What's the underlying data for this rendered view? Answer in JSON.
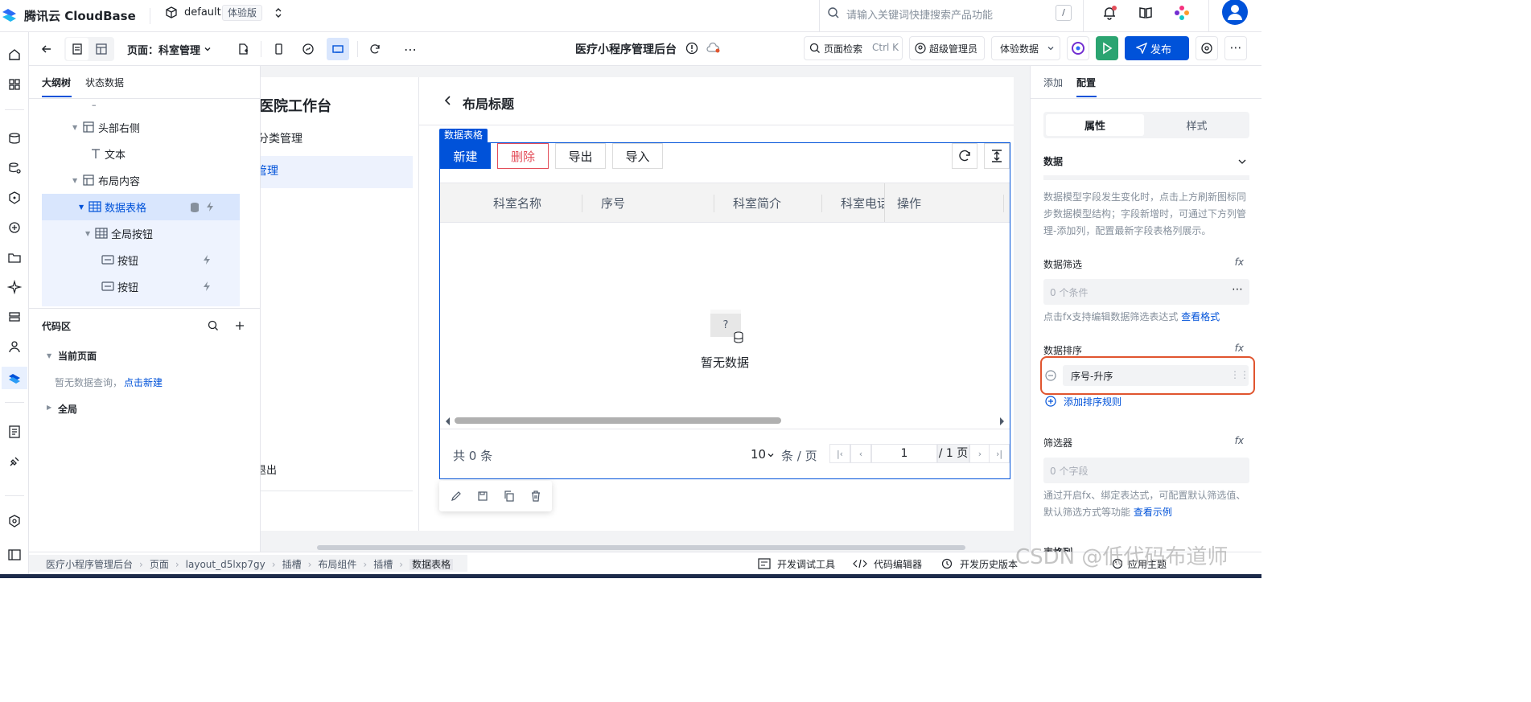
{
  "topbar": {
    "brand": "腾讯云 CloudBase",
    "env_name": "default",
    "env_badge": "体验版",
    "search_placeholder": "请输入关键词快捷搜索产品功能",
    "search_shortcut": "/"
  },
  "toolbar": {
    "page_label": "页面：科室管理",
    "app_title": "医疗小程序管理后台",
    "page_search": "页面检索",
    "page_search_shortcut": "Ctrl K",
    "role": "超级管理员",
    "data_mode": "体验数据",
    "publish": "发布"
  },
  "outline": {
    "tabs": [
      "大纲树",
      "状态数据"
    ],
    "dash": "–",
    "tree": [
      {
        "label": "头部右侧",
        "icon": "layout-icon"
      },
      {
        "label": "文本",
        "icon": "text-icon"
      },
      {
        "label": "布局内容",
        "icon": "layout-icon"
      },
      {
        "label": "数据表格",
        "icon": "table-icon"
      },
      {
        "label": "全局按钮",
        "icon": "table-icon"
      },
      {
        "label": "按钮",
        "icon": "button-icon"
      },
      {
        "label": "按钮",
        "icon": "button-icon"
      }
    ],
    "code": {
      "title": "代码区",
      "current_page": "当前页面",
      "empty_text": "暂无数据查询，",
      "create_link": "点击新建",
      "global": "全局"
    }
  },
  "canvas": {
    "sidebar_title": "医院工作台",
    "sidebar_items": [
      "分类管理",
      "管理"
    ],
    "logout": "退出",
    "header_title": "布局标题",
    "component_tag": "数据表格",
    "buttons": {
      "new": "新建",
      "delete": "删除",
      "export": "导出",
      "import": "导入"
    },
    "columns": [
      "科室名称",
      "序号",
      "科室简介",
      "科室电话",
      "操作"
    ],
    "empty": "暂无数据",
    "empty_icon_text": "?",
    "total_prefix": "共",
    "total_count": "0",
    "total_suffix": "条",
    "page_size": "10",
    "page_size_unit": "条 / 页",
    "page_current": "1",
    "page_total": "/ 1 页"
  },
  "rightpanel": {
    "tabs": [
      "添加",
      "配置"
    ],
    "seg": [
      "属性",
      "样式"
    ],
    "section": "数据",
    "help1": "数据模型字段发生变化时，点击上方刷新图标同步数据模型结构；字段新增时，可通过下方列管理-添加列，配置最新字段表格列展示。",
    "filter_label": "数据筛选",
    "filter_value": "0 个条件",
    "filter_help": "点击fx支持编辑数据筛选表达式 ",
    "filter_link": "查看格式",
    "sort_label": "数据排序",
    "sort_item": "序号-升序",
    "add_sort": "添加排序规则",
    "selector_label": "筛选器",
    "selector_value": "0 个字段",
    "selector_help": "通过开启fx、绑定表达式，可配置默认筛选值、默认筛选方式等功能 ",
    "selector_link": "查看示例",
    "fx": "fx",
    "next_label": "表格列"
  },
  "bottombar": {
    "breadcrumb": [
      "医疗小程序管理后台",
      "页面",
      "layout_d5lxp7gy",
      "插槽",
      "布局组件",
      "插槽",
      "数据表格"
    ],
    "debug": "开发调试工具",
    "code_editor": "代码编辑器",
    "history": "开发历史版本",
    "theme": "应用主题"
  },
  "watermark": "CSDN @低代码布道师",
  "colors": {
    "primary": "#0052d9",
    "danger": "#e34d59",
    "highlight": "#e0552f",
    "publish": "#0052d9",
    "run": "#2ba471"
  }
}
